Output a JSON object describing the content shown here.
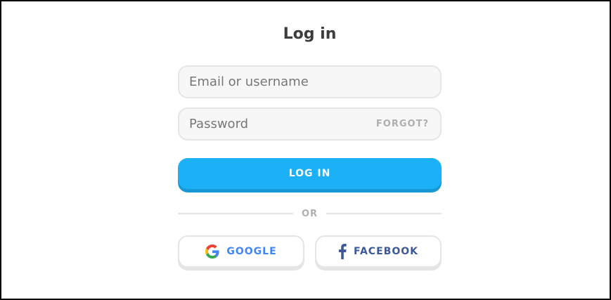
{
  "page": {
    "title": "Log in"
  },
  "form": {
    "email": {
      "value": "",
      "placeholder": "Email or username"
    },
    "password": {
      "value": "",
      "placeholder": "Password",
      "forgot_label": "FORGOT?"
    },
    "login_label": "LOG IN",
    "divider_label": "OR"
  },
  "social": {
    "google_label": "GOOGLE",
    "google_icon": "google-g-icon",
    "facebook_label": "FACEBOOK",
    "facebook_icon": "facebook-f-icon"
  },
  "colors": {
    "primary": "#1cb0f6",
    "primary_shadow": "#1899d6",
    "google_text": "#4285f4",
    "facebook_text": "#3b5998",
    "muted": "#afafaf",
    "field_bg": "#f7f7f7",
    "border": "#e5e5e5"
  }
}
